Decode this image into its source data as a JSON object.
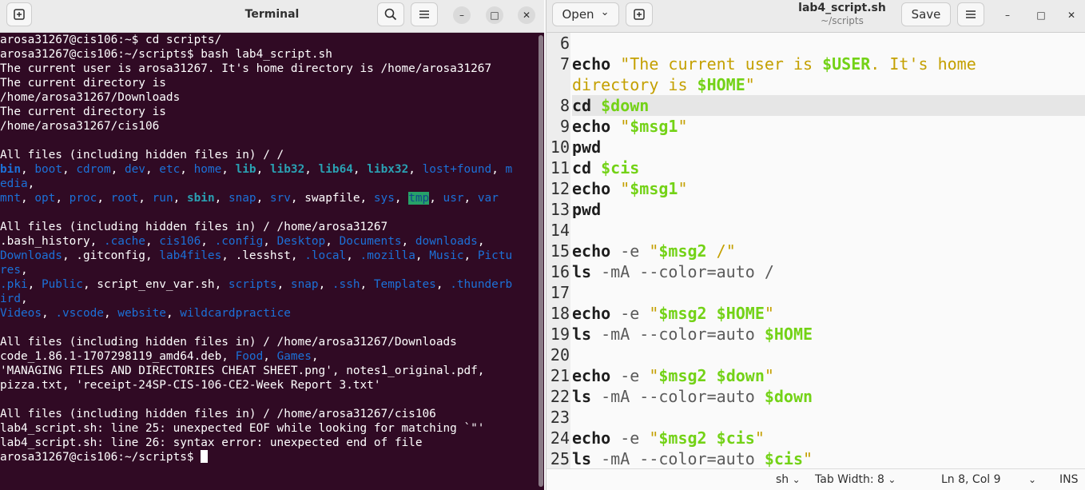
{
  "terminal": {
    "title": "Terminal",
    "lines": [
      [
        {
          "t": "arosa31267@cis106:~$ cd scripts/"
        }
      ],
      [
        {
          "t": "arosa31267@cis106:~/scripts$ bash lab4_script.sh"
        }
      ],
      [
        {
          "t": "The current user is arosa31267. It's home directory is /home/arosa31267"
        }
      ],
      [
        {
          "t": "The current directory is"
        }
      ],
      [
        {
          "t": "/home/arosa31267/Downloads"
        }
      ],
      [
        {
          "t": "The current directory is"
        }
      ],
      [
        {
          "t": "/home/arosa31267/cis106"
        }
      ],
      [
        {
          "t": ""
        }
      ],
      [
        {
          "t": "All files (including hidden files in) / /"
        }
      ],
      [
        {
          "t": "bin",
          "c": "c-blue c-b"
        },
        {
          "t": ", "
        },
        {
          "t": "boot",
          "c": "c-blue"
        },
        {
          "t": ", "
        },
        {
          "t": "cdrom",
          "c": "c-blue"
        },
        {
          "t": ", "
        },
        {
          "t": "dev",
          "c": "c-blue"
        },
        {
          "t": ", "
        },
        {
          "t": "etc",
          "c": "c-blue"
        },
        {
          "t": ", "
        },
        {
          "t": "home",
          "c": "c-blue"
        },
        {
          "t": ", "
        },
        {
          "t": "lib",
          "c": "c-cyan c-b"
        },
        {
          "t": ", "
        },
        {
          "t": "lib32",
          "c": "c-cyan c-b"
        },
        {
          "t": ", "
        },
        {
          "t": "lib64",
          "c": "c-cyan c-b"
        },
        {
          "t": ", "
        },
        {
          "t": "libx32",
          "c": "c-cyan c-b"
        },
        {
          "t": ", "
        },
        {
          "t": "lost+found",
          "c": "c-blue"
        },
        {
          "t": ", "
        },
        {
          "t": "m",
          "c": "c-blue"
        }
      ],
      [
        {
          "t": "edia",
          "c": "c-blue"
        },
        {
          "t": ","
        }
      ],
      [
        {
          "t": "mnt",
          "c": "c-blue"
        },
        {
          "t": ", "
        },
        {
          "t": "opt",
          "c": "c-blue"
        },
        {
          "t": ", "
        },
        {
          "t": "proc",
          "c": "c-blue"
        },
        {
          "t": ", "
        },
        {
          "t": "root",
          "c": "c-blue"
        },
        {
          "t": ", "
        },
        {
          "t": "run",
          "c": "c-blue"
        },
        {
          "t": ", "
        },
        {
          "t": "sbin",
          "c": "c-cyan c-b"
        },
        {
          "t": ", "
        },
        {
          "t": "snap",
          "c": "c-blue"
        },
        {
          "t": ", "
        },
        {
          "t": "srv",
          "c": "c-blue"
        },
        {
          "t": ", swapfile, "
        },
        {
          "t": "sys",
          "c": "c-blue"
        },
        {
          "t": ", "
        },
        {
          "t": "tmp",
          "c": "c-hl"
        },
        {
          "t": ", "
        },
        {
          "t": "usr",
          "c": "c-blue"
        },
        {
          "t": ", "
        },
        {
          "t": "var",
          "c": "c-blue"
        }
      ],
      [
        {
          "t": ""
        }
      ],
      [
        {
          "t": "All files (including hidden files in) / /home/arosa31267"
        }
      ],
      [
        {
          "t": ".bash_history, "
        },
        {
          "t": ".cache",
          "c": "c-blue"
        },
        {
          "t": ", "
        },
        {
          "t": "cis106",
          "c": "c-blue"
        },
        {
          "t": ", "
        },
        {
          "t": ".config",
          "c": "c-blue"
        },
        {
          "t": ", "
        },
        {
          "t": "Desktop",
          "c": "c-blue"
        },
        {
          "t": ", "
        },
        {
          "t": "Documents",
          "c": "c-blue"
        },
        {
          "t": ", "
        },
        {
          "t": "downloads",
          "c": "c-blue"
        },
        {
          "t": ","
        }
      ],
      [
        {
          "t": "Downloads",
          "c": "c-blue"
        },
        {
          "t": ", .gitconfig, "
        },
        {
          "t": "lab4files",
          "c": "c-blue"
        },
        {
          "t": ", .lesshst, "
        },
        {
          "t": ".local",
          "c": "c-blue"
        },
        {
          "t": ", "
        },
        {
          "t": ".mozilla",
          "c": "c-blue"
        },
        {
          "t": ", "
        },
        {
          "t": "Music",
          "c": "c-blue"
        },
        {
          "t": ", "
        },
        {
          "t": "Pictu",
          "c": "c-blue"
        }
      ],
      [
        {
          "t": "res",
          "c": "c-blue"
        },
        {
          "t": ","
        }
      ],
      [
        {
          "t": ".pki",
          "c": "c-blue"
        },
        {
          "t": ", "
        },
        {
          "t": "Public",
          "c": "c-blue"
        },
        {
          "t": ", script_env_var.sh, "
        },
        {
          "t": "scripts",
          "c": "c-blue"
        },
        {
          "t": ", "
        },
        {
          "t": "snap",
          "c": "c-blue"
        },
        {
          "t": ", "
        },
        {
          "t": ".ssh",
          "c": "c-blue"
        },
        {
          "t": ", "
        },
        {
          "t": "Templates",
          "c": "c-blue"
        },
        {
          "t": ", "
        },
        {
          "t": ".thunderb",
          "c": "c-blue"
        }
      ],
      [
        {
          "t": "ird",
          "c": "c-blue"
        },
        {
          "t": ","
        }
      ],
      [
        {
          "t": "Videos",
          "c": "c-blue"
        },
        {
          "t": ", "
        },
        {
          "t": ".vscode",
          "c": "c-blue"
        },
        {
          "t": ", "
        },
        {
          "t": "website",
          "c": "c-blue"
        },
        {
          "t": ", "
        },
        {
          "t": "wildcardpractice",
          "c": "c-blue"
        }
      ],
      [
        {
          "t": ""
        }
      ],
      [
        {
          "t": "All files (including hidden files in) / /home/arosa31267/Downloads"
        }
      ],
      [
        {
          "t": "code_1.86.1-1707298119_amd64.deb, "
        },
        {
          "t": "Food",
          "c": "c-blue"
        },
        {
          "t": ", "
        },
        {
          "t": "Games",
          "c": "c-blue"
        },
        {
          "t": ","
        }
      ],
      [
        {
          "t": "'MANAGING FILES AND DIRECTORIES CHEAT SHEET.png', notes1_original.pdf,"
        }
      ],
      [
        {
          "t": "pizza.txt, 'receipt-24SP-CIS-106-CE2-Week Report 3.txt'"
        }
      ],
      [
        {
          "t": ""
        }
      ],
      [
        {
          "t": "All files (including hidden files in) / /home/arosa31267/cis106"
        }
      ],
      [
        {
          "t": "lab4_script.sh: line 25: unexpected EOF while looking for matching `\"'"
        }
      ],
      [
        {
          "t": "lab4_script.sh: line 26: syntax error: unexpected end of file"
        }
      ],
      [
        {
          "t": "arosa31267@cis106:~/scripts$ "
        }
      ]
    ]
  },
  "editor": {
    "open_label": "Open",
    "title": "lab4_script.sh",
    "subtitle": "~/scripts",
    "save_label": "Save",
    "line_numbers": [
      "6",
      "7",
      "",
      "8",
      "9",
      "10",
      "11",
      "12",
      "13",
      "14",
      "15",
      "16",
      "17",
      "18",
      "19",
      "20",
      "21",
      "22",
      "23",
      "24",
      "25"
    ],
    "current_row": 3,
    "lines": [
      [
        {
          "t": ""
        }
      ],
      [
        {
          "t": "echo",
          "c": "kw"
        },
        {
          "t": " \"The current user is ",
          "c": "st"
        },
        {
          "t": "$USER",
          "c": "vr"
        },
        {
          "t": ". It's home",
          "c": "st"
        }
      ],
      [
        {
          "t": "directory is ",
          "c": "st"
        },
        {
          "t": "$HOME",
          "c": "vr"
        },
        {
          "t": "\"",
          "c": "st"
        }
      ],
      [
        {
          "t": "cd",
          "c": "kw"
        },
        {
          "t": " "
        },
        {
          "t": "$down",
          "c": "vr"
        }
      ],
      [
        {
          "t": "echo",
          "c": "kw"
        },
        {
          "t": " \"",
          "c": "st"
        },
        {
          "t": "$msg1",
          "c": "vr"
        },
        {
          "t": "\"",
          "c": "st"
        }
      ],
      [
        {
          "t": "pwd",
          "c": "kw"
        }
      ],
      [
        {
          "t": "cd",
          "c": "kw"
        },
        {
          "t": " "
        },
        {
          "t": "$cis",
          "c": "vr"
        }
      ],
      [
        {
          "t": "echo",
          "c": "kw"
        },
        {
          "t": " \"",
          "c": "st"
        },
        {
          "t": "$msg1",
          "c": "vr"
        },
        {
          "t": "\"",
          "c": "st"
        }
      ],
      [
        {
          "t": "pwd",
          "c": "kw"
        }
      ],
      [
        {
          "t": ""
        }
      ],
      [
        {
          "t": "echo",
          "c": "kw"
        },
        {
          "t": " -e ",
          "c": "op"
        },
        {
          "t": "\"",
          "c": "st"
        },
        {
          "t": "$msg2",
          "c": "vr"
        },
        {
          "t": " /\"",
          "c": "st"
        }
      ],
      [
        {
          "t": "ls",
          "c": "kw"
        },
        {
          "t": " -mA --color=auto /",
          "c": "op"
        }
      ],
      [
        {
          "t": ""
        }
      ],
      [
        {
          "t": "echo",
          "c": "kw"
        },
        {
          "t": " -e ",
          "c": "op"
        },
        {
          "t": "\"",
          "c": "st"
        },
        {
          "t": "$msg2",
          "c": "vr"
        },
        {
          "t": " ",
          "c": "st"
        },
        {
          "t": "$HOME",
          "c": "vr"
        },
        {
          "t": "\"",
          "c": "st"
        }
      ],
      [
        {
          "t": "ls",
          "c": "kw"
        },
        {
          "t": " -mA --color=auto ",
          "c": "op"
        },
        {
          "t": "$HOME",
          "c": "vr"
        }
      ],
      [
        {
          "t": ""
        }
      ],
      [
        {
          "t": "echo",
          "c": "kw"
        },
        {
          "t": " -e ",
          "c": "op"
        },
        {
          "t": "\"",
          "c": "st"
        },
        {
          "t": "$msg2",
          "c": "vr"
        },
        {
          "t": " ",
          "c": "st"
        },
        {
          "t": "$down",
          "c": "vr"
        },
        {
          "t": "\"",
          "c": "st"
        }
      ],
      [
        {
          "t": "ls",
          "c": "kw"
        },
        {
          "t": " -mA --color=auto ",
          "c": "op"
        },
        {
          "t": "$down",
          "c": "vr"
        }
      ],
      [
        {
          "t": ""
        }
      ],
      [
        {
          "t": "echo",
          "c": "kw"
        },
        {
          "t": " -e ",
          "c": "op"
        },
        {
          "t": "\"",
          "c": "st"
        },
        {
          "t": "$msg2",
          "c": "vr"
        },
        {
          "t": " ",
          "c": "st"
        },
        {
          "t": "$cis",
          "c": "vr"
        },
        {
          "t": "\"",
          "c": "st"
        }
      ],
      [
        {
          "t": "ls",
          "c": "kw"
        },
        {
          "t": " -mA --color=auto ",
          "c": "op"
        },
        {
          "t": "$cis",
          "c": "vr"
        },
        {
          "t": "\"",
          "c": "st"
        }
      ]
    ],
    "status": {
      "language": "sh",
      "tab_width": "Tab Width: 8",
      "position": "Ln 8, Col 9",
      "mode": "INS"
    }
  },
  "icons": {
    "new_tab": "⊞",
    "search": "⌕",
    "menu": "☰",
    "minimize": "–",
    "maximize": "□",
    "close": "✕",
    "chevron": "⌄"
  }
}
